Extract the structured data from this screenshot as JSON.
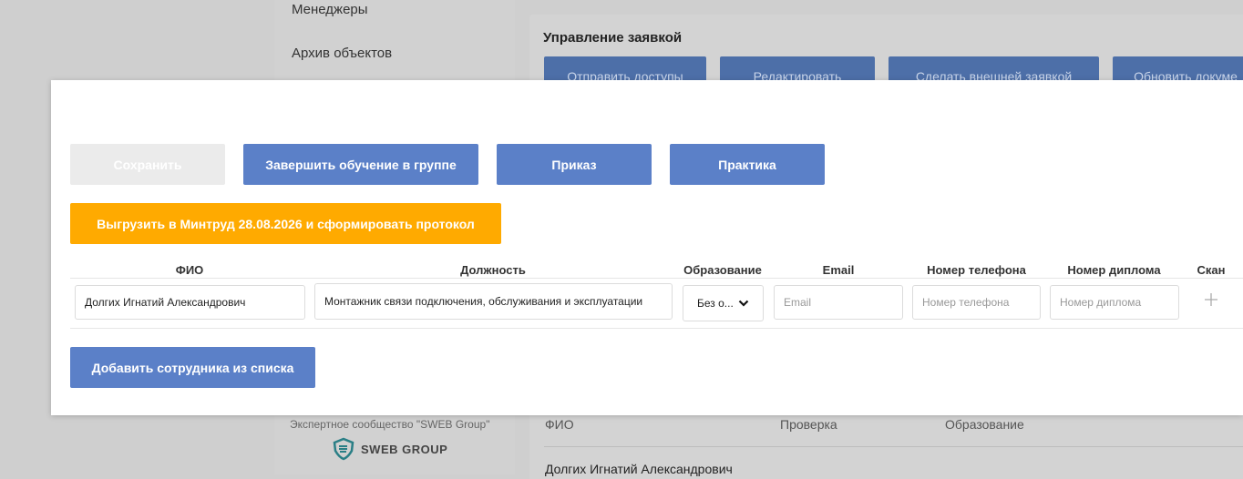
{
  "background": {
    "nav_items": [
      "Менеджеры",
      "Архив объектов"
    ],
    "panel_title": "Управление заявкой",
    "panel_buttons": [
      "Отправить доступы",
      "Редактировать",
      "Сделать внешней заявкой",
      "Обновить докуме"
    ],
    "columns": [
      "ФИО",
      "Проверка",
      "Образование"
    ],
    "row_name": "Долгих Игнатий Александрович",
    "footer_text": "Экспертное сообщество \"SWEB Group\"",
    "logo_text": "SWEB GROUP"
  },
  "modal": {
    "buttons": {
      "save": "Сохранить",
      "finish_group": "Завершить обучение в группе",
      "order": "Приказ",
      "practice": "Практика",
      "export": "Выгрузить в Минтруд 28.08.2026 и сформировать протокол",
      "add_employee": "Добавить сотрудника из списка"
    },
    "table": {
      "headers": [
        "ФИО",
        "Должность",
        "Образование",
        "Email",
        "Номер телефона",
        "Номер диплома",
        "Скан"
      ],
      "row": {
        "fio": "Долгих Игнатий Александрович",
        "position": "Монтажник связи подключения, обслуживания и эксплуатации",
        "education": "Без о...",
        "email_placeholder": "Email",
        "phone_placeholder": "Номер телефона",
        "diploma_placeholder": "Номер диплома"
      }
    }
  },
  "colors": {
    "primary": "#5b80c8",
    "orange": "#ffaa00",
    "disabled": "#ebebeb"
  }
}
